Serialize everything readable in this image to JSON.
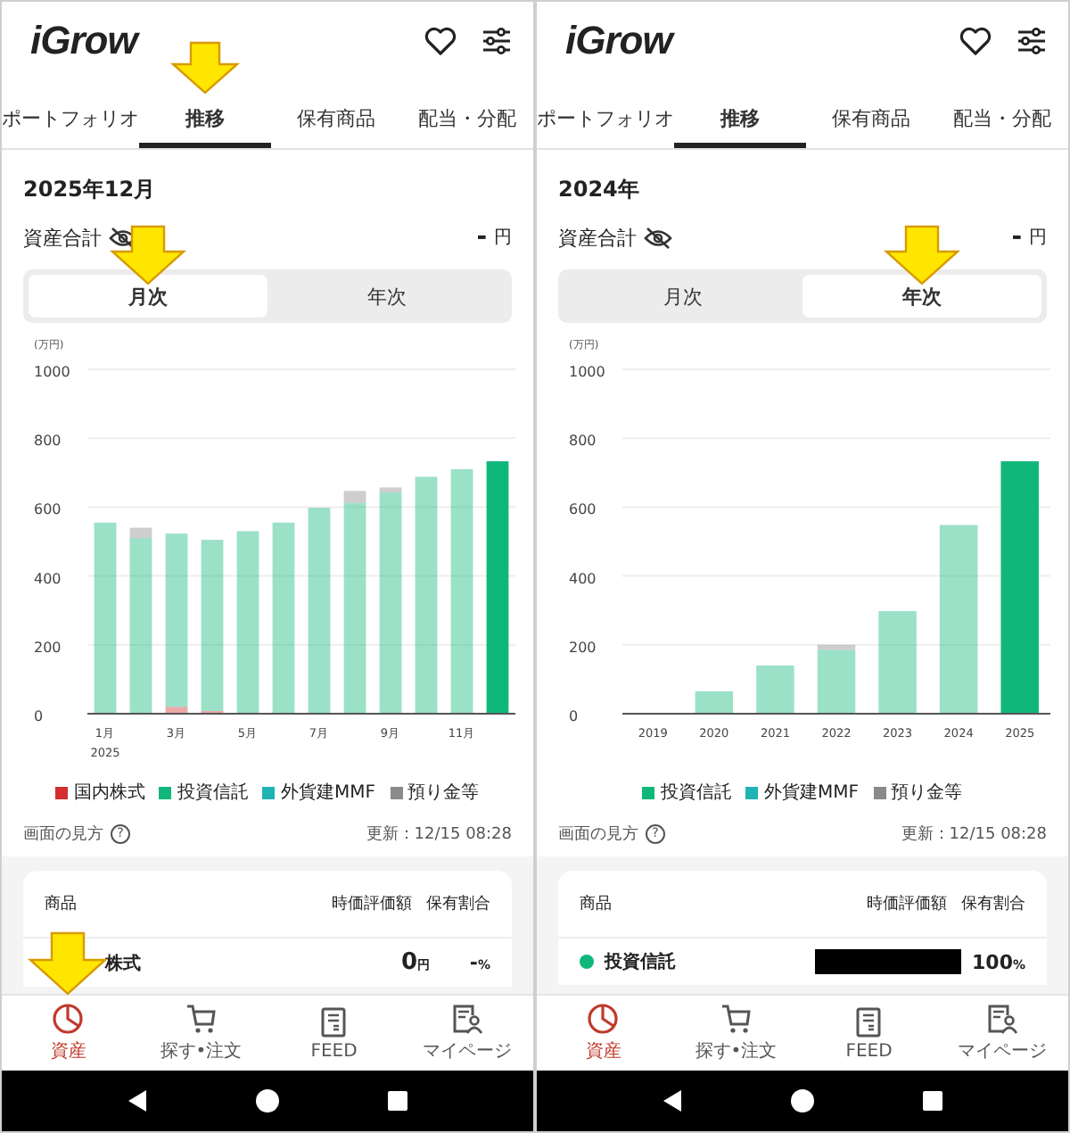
{
  "screens": [
    {
      "logo": "iGrow",
      "tabs": [
        {
          "label": "ポートフォリオ",
          "selected": false,
          "arrow": false
        },
        {
          "label": "推移",
          "selected": true,
          "arrow": true
        },
        {
          "label": "保有商品",
          "selected": false,
          "arrow": false
        },
        {
          "label": "配当・分配",
          "selected": false,
          "arrow": false
        }
      ],
      "period": "2025年12月",
      "total_label": "資産合計",
      "total_value": "-",
      "total_unit": "円",
      "segments": [
        {
          "label": "月次",
          "selected": true,
          "arrow": true
        },
        {
          "label": "年次",
          "selected": false,
          "arrow": false
        }
      ],
      "chart_data": {
        "type": "bar",
        "stacked": true,
        "grid": true,
        "ylabel": "(万円)",
        "x": [
          1,
          2,
          3,
          4,
          5,
          6,
          7,
          8,
          9,
          10,
          11,
          12
        ],
        "xlim": [
          0.5,
          12.5
        ],
        "ylim": [
          0,
          1000
        ],
        "yticks": [
          0,
          200,
          400,
          600,
          800,
          1000
        ],
        "legend": "bottom",
        "annotations": [
          "2025"
        ],
        "xticks": [
          {
            "value": 1,
            "label": "1月"
          },
          {
            "value": 3,
            "label": "3月"
          },
          {
            "value": 5,
            "label": "5月"
          },
          {
            "value": 7,
            "label": "7月"
          },
          {
            "value": 9,
            "label": "9月"
          },
          {
            "value": 11,
            "label": "11月"
          }
        ],
        "series": [
          {
            "name": "国内株式",
            "color": "#d32f2f",
            "values": [
              null,
              null,
              20,
              8,
              null,
              null,
              null,
              null,
              null,
              null,
              null,
              null
            ]
          },
          {
            "name": "投資信託",
            "color": "#10b77a",
            "values": [
              555,
              510,
              503,
              497,
              530,
              555,
              598,
              612,
              642,
              688,
              710,
              733
            ]
          },
          {
            "name": "外貨建MMF",
            "color": "#1fb3b3",
            "values": [
              null,
              null,
              null,
              null,
              null,
              null,
              null,
              null,
              null,
              null,
              null,
              null
            ]
          },
          {
            "name": "預り金等",
            "color": "#8a8a8a",
            "values": [
              null,
              30,
              null,
              null,
              null,
              null,
              null,
              35,
              15,
              null,
              null,
              null
            ]
          }
        ]
      },
      "help_label": "画面の見方",
      "help_icon": "?",
      "updated": "更新：12/15 08:28",
      "table_columns": [
        "商品",
        "時価評価額",
        "保有割合"
      ],
      "row": {
        "name": "株式",
        "value": "0",
        "unit": "円",
        "share": "-",
        "share_unit": "%"
      },
      "nav": [
        {
          "label": "資産",
          "selected": true,
          "arrow": true
        },
        {
          "label": "探す•注文",
          "selected": false,
          "arrow": false
        },
        {
          "label": "FEED",
          "selected": false,
          "arrow": false
        },
        {
          "label": "マイページ",
          "selected": false,
          "arrow": false
        }
      ]
    },
    {
      "logo": "iGrow",
      "tabs": [
        {
          "label": "ポートフォリオ",
          "selected": false,
          "arrow": false
        },
        {
          "label": "推移",
          "selected": true,
          "arrow": false
        },
        {
          "label": "保有商品",
          "selected": false,
          "arrow": false
        },
        {
          "label": "配当・分配",
          "selected": false,
          "arrow": false
        }
      ],
      "period": "2024年",
      "total_label": "資産合計",
      "total_value": "-",
      "total_unit": "円",
      "segments": [
        {
          "label": "月次",
          "selected": false,
          "arrow": false
        },
        {
          "label": "年次",
          "selected": true,
          "arrow": true
        }
      ],
      "chart_data": {
        "type": "bar",
        "stacked": true,
        "grid": true,
        "legend": "bottom",
        "ylabel": "(万円)",
        "categories": [
          "2019",
          "2020",
          "2021",
          "2022",
          "2023",
          "2024",
          "2025"
        ],
        "ylim": [
          0,
          1000
        ],
        "yticks": [
          0,
          200,
          400,
          600,
          800,
          1000
        ],
        "series": [
          {
            "name": "投資信託",
            "color": "#10b77a",
            "values": [
              null,
              65,
              140,
              185,
              298,
              548,
              733
            ]
          },
          {
            "name": "外貨建MMF",
            "color": "#1fb3b3",
            "values": [
              null,
              null,
              null,
              null,
              null,
              null,
              null
            ]
          },
          {
            "name": "預り金等",
            "color": "#8a8a8a",
            "values": [
              null,
              null,
              null,
              15,
              null,
              null,
              null
            ]
          }
        ]
      },
      "help_label": "画面の見方",
      "help_icon": "?",
      "updated": "更新：12/15 08:28",
      "table_columns": [
        "商品",
        "時価評価額",
        "保有割合"
      ],
      "row": {
        "name": "投資信託",
        "color": "#10b77a",
        "redacted": true,
        "share": "100",
        "share_unit": "%"
      },
      "nav": [
        {
          "label": "資産",
          "selected": true,
          "arrow": false
        },
        {
          "label": "探す•注文",
          "selected": false,
          "arrow": false
        },
        {
          "label": "FEED",
          "selected": false,
          "arrow": false
        },
        {
          "label": "マイページ",
          "selected": false,
          "arrow": false
        }
      ]
    }
  ]
}
